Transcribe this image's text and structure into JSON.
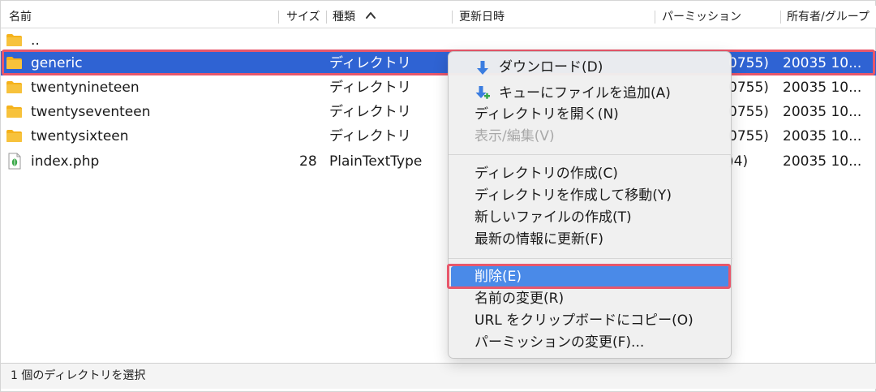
{
  "columns": {
    "name": "名前",
    "size": "サイズ",
    "type": "種類",
    "modified": "更新日時",
    "permission": "パーミッション",
    "owner": "所有者/グループ"
  },
  "parent_dir": "..",
  "rows": [
    {
      "name": "generic",
      "size": "",
      "type": "ディレクトリ",
      "perm": "0755)",
      "owner": "20035 10...",
      "icon": "folder-icon"
    },
    {
      "name": "twentynineteen",
      "size": "",
      "type": "ディレクトリ",
      "perm": "0755)",
      "owner": "20035 10...",
      "icon": "folder-icon"
    },
    {
      "name": "twentyseventeen",
      "size": "",
      "type": "ディレクトリ",
      "perm": "0755)",
      "owner": "20035 10...",
      "icon": "folder-icon"
    },
    {
      "name": "twentysixteen",
      "size": "",
      "type": "ディレクトリ",
      "perm": "0755)",
      "owner": "20035 10...",
      "icon": "folder-icon"
    },
    {
      "name": "index.php",
      "size": "28",
      "type": "PlainTextType",
      "perm": ")4)",
      "owner": "20035 10...",
      "icon": "php-file-icon"
    }
  ],
  "selected_row": "generic",
  "context_menu": {
    "download": "ダウンロード(D)",
    "add_to_queue": "キューにファイルを追加(A)",
    "open_dir": "ディレクトリを開く(N)",
    "view_edit": "表示/編集(V)",
    "create_dir": "ディレクトリの作成(C)",
    "create_dir_move": "ディレクトリを作成して移動(Y)",
    "new_file": "新しいファイルの作成(T)",
    "refresh": "最新の情報に更新(F)",
    "delete": "削除(E)",
    "rename": "名前の変更(R)",
    "copy_url": "URL をクリップボードにコピー(O)",
    "permissions": "パーミッションの変更(F)..."
  },
  "status": "1 個のディレクトリを選択",
  "colors": {
    "selection": "#2f63d3",
    "menu_highlight": "#4a8ae8",
    "annotation_outline": "#e8576b",
    "folder": "#f5b21b"
  }
}
